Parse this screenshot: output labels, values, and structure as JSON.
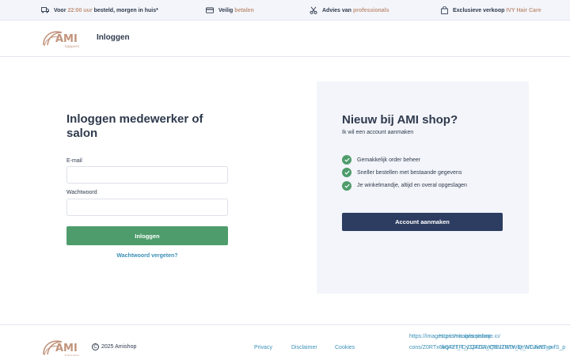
{
  "usp_bar": {
    "items": [
      {
        "icon": "truck-icon",
        "prefix": "Voor",
        "highlight": "22:00 uur",
        "suffix": "besteld, morgen in huis*"
      },
      {
        "icon": "credit-card-icon",
        "prefix": "Veilig",
        "highlight": "betalen",
        "suffix": ""
      },
      {
        "icon": "scissors-icon",
        "prefix": "Advies van",
        "highlight": "professionals",
        "suffix": ""
      },
      {
        "icon": "shopping-bag-icon",
        "prefix": "Exclusieve verkoop",
        "highlight": "IVY Hair Care",
        "suffix": ""
      }
    ]
  },
  "header": {
    "logo_text": "AMI",
    "logo_subtext": "kappers",
    "title": "Inloggen"
  },
  "login": {
    "title": "Inloggen medewerker of salon",
    "email_label": "E-mail",
    "email_value": "",
    "password_label": "Wachtwoord",
    "password_value": "",
    "submit_label": "Inloggen",
    "forgot_label": "Wachtwoord vergeten?"
  },
  "register": {
    "title": "Nieuw bij AMI shop?",
    "subtitle": "Ik wil een account aanmaken",
    "benefits": [
      "Gemakkelijk order beheer",
      "Sneller bestellen met bestaande gegevens",
      "Je winkelmandje, altijd en overal opgeslagen"
    ],
    "button_label": "Account aanmaken"
  },
  "footer": {
    "logo_text": "AMI",
    "logo_subtext": "kappers",
    "copyright_symbol": "C",
    "copyright": "2025 Amishop",
    "links": [
      "Privacy",
      "Disclaimer",
      "Cookies"
    ],
    "broken_image_text": {
      "line1": "https://images.prismic.io/amishop-",
      "line2": "cons/Z0RTx6bqAZTFDyJZFGAWTEJZNTWbrrWCJkNTwwfS_p",
      "line1_overlay": "https://images.prismic.io/",
      "line2_overlay": "AQ7EI_T_ZQ4ZEt_QBNTWbr_Q_NTwwfS_p"
    }
  },
  "colors": {
    "accent_copper": "#c1937b",
    "navy": "#2d3c61",
    "green": "#4e9c6b",
    "link_blue": "#3a8fb7",
    "panel_bg": "#f3f5fa"
  }
}
